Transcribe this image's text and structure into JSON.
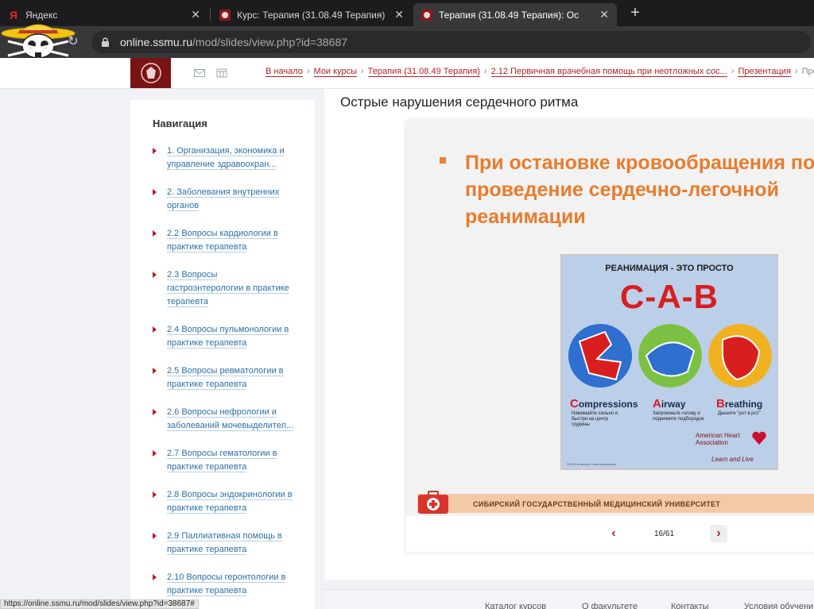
{
  "browser": {
    "tabs": [
      {
        "title": "Яндекс",
        "icon": "yandex-icon"
      },
      {
        "title": "Курс: Терапия (31.08.49 Терапия)",
        "icon": "ssmu-favicon"
      },
      {
        "title": "Терапия (31.08.49 Терапия): Ос",
        "icon": "ssmu-favicon"
      }
    ],
    "url_host": "online.ssmu.ru",
    "url_path": "/mod/slides/view.php?id=38687"
  },
  "header": {
    "breadcrumb": [
      "В начало",
      "Мои курсы",
      "Терапия (31.08.49 Терапия)",
      "2.12 Первичная врачебная помощь при неотложных сос...",
      "Презентация"
    ],
    "breadcrumb_last": "Презе"
  },
  "sidebar": {
    "title": "Навигация",
    "items": [
      {
        "label": "1. Организация, экономика и управление здравоохран..."
      },
      {
        "label": "2. Заболевания внутренних органов"
      },
      {
        "label": "2.2 Вопросы кардиологии в практике терапевта"
      },
      {
        "label": "2.3 Вопросы гастроэнтерологии в практике терапевта"
      },
      {
        "label": "2.4 Вопросы пульмонологии в практике терапевта"
      },
      {
        "label": "2.5 Вопросы ревматологии в практике терапевта"
      },
      {
        "label": "2.6 Вопросы нефрологии и заболеваний мочевыделител..."
      },
      {
        "label": "2.7 Вопросы гематологии в практике терапевта"
      },
      {
        "label": "2.8 Вопросы эндокринологии в практике терапевта"
      },
      {
        "label": "2.9 Паллиативная помощь в практике терапевта"
      },
      {
        "label": "2.10 Вопросы геронтологии в практике терапевта"
      }
    ]
  },
  "main": {
    "title": "Острые нарушения сердечного ритма",
    "slide": {
      "line1": "При остановке кровообращения по",
      "line2": "проведение сердечно-легочной",
      "line3": "реанимации",
      "poster": {
        "heading": "РЕАНИМАЦИЯ - ЭТО ПРОСТО",
        "big": "C-A-B",
        "c_word_first": "C",
        "c_word_rest": "ompressions",
        "a_word_first": "A",
        "a_word_rest": "irway",
        "b_word_first": "B",
        "b_word_rest": "reathing",
        "c_desc": "Нажимайте сильно и быстро на центр грудины",
        "a_desc": "Запрокиньте голову и поднимите подбородок",
        "b_desc": "Дышите \"рот в рот\"",
        "aha": "American Heart Association",
        "tagline": "Learn and Live",
        "copyright": "©2010 American Heart Association"
      },
      "footer_text": "СИБИРСКИЙ ГОСУДАРСТВЕННЫЙ МЕДИЦИНСКИЙ УНИВЕРСИТЕТ"
    },
    "counter": "16/61"
  },
  "footer": {
    "links": [
      "Каталог курсов",
      "О факультете",
      "Контакты",
      "Условия обучени"
    ]
  },
  "status_url": "https://online.ssmu.ru/mod/slides/view.php?id=38687#",
  "colors": {
    "accent": "#b51f1f",
    "slide_orange": "#e87c2c",
    "link_blue": "#2a6fa8"
  }
}
